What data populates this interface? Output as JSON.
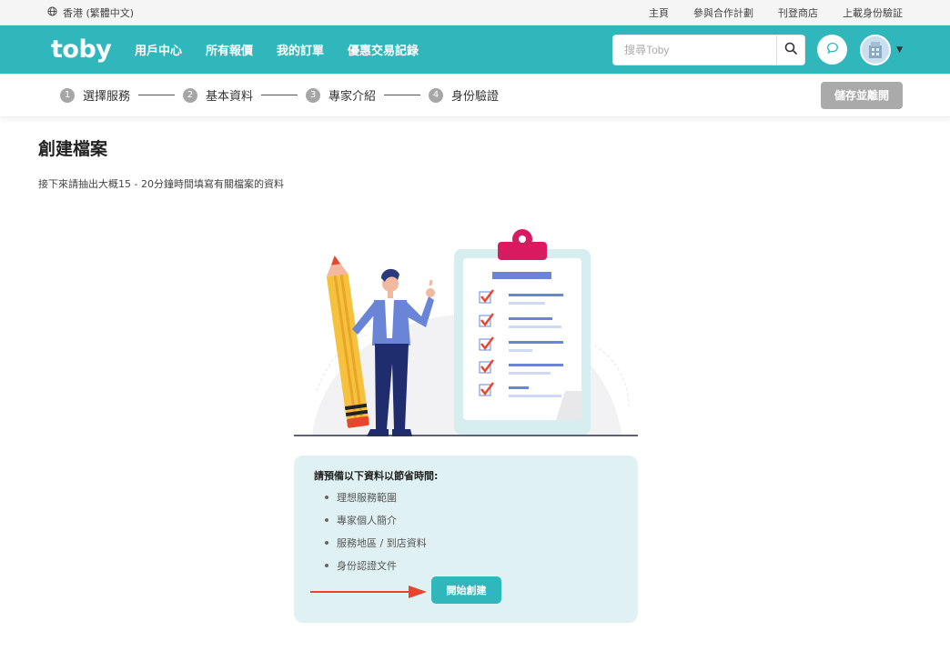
{
  "utilbar": {
    "locale": "香港 (繁體中文)",
    "links": [
      "主頁",
      "參與合作計劃",
      "刊登商店",
      "上載身份驗証"
    ]
  },
  "header": {
    "logo": "toby",
    "nav": [
      "用戶中心",
      "所有報價",
      "我的訂單",
      "優惠交易記錄"
    ],
    "search_placeholder": "搜尋Toby"
  },
  "steps": [
    {
      "num": "1",
      "label": "選擇服務"
    },
    {
      "num": "2",
      "label": "基本資料"
    },
    {
      "num": "3",
      "label": "專家介紹"
    },
    {
      "num": "4",
      "label": "身份驗證"
    }
  ],
  "save_button": "儲存並離開",
  "page": {
    "title": "創建檔案",
    "subtitle": "接下來請抽出大概15 - 20分鐘時間填寫有關檔案的資料"
  },
  "card": {
    "title": "請預備以下資料以節省時間:",
    "items": [
      "理想服務範圍",
      "專家個人簡介",
      "服務地區 / 到店資料",
      "身份認證文件"
    ],
    "start_button": "開始創建"
  },
  "icons": [
    "globe-icon",
    "search-icon",
    "chat-icon",
    "avatar-image",
    "caret-down-icon",
    "red-arrow-icon"
  ],
  "colors": {
    "brand": "#2fb7bc",
    "card_bg": "#e0f1f3",
    "save_disabled": "#aaaaaa",
    "arrow": "#e8452c"
  }
}
